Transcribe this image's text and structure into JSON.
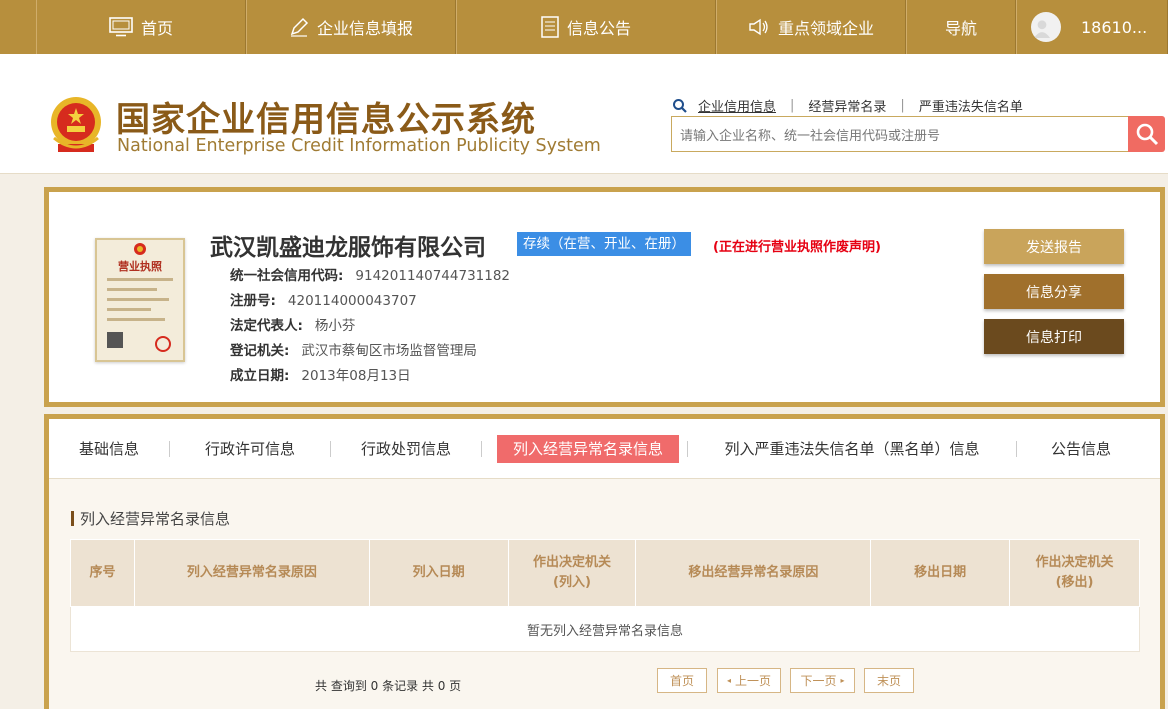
{
  "topnav": {
    "home": "首页",
    "report": "企业信息填报",
    "notice": "信息公告",
    "key": "重点领域企业",
    "guide": "导航",
    "user": "18610..."
  },
  "header": {
    "title": "国家企业信用信息公示系统",
    "subtitle": "National Enterprise Credit Information Publicity System",
    "search_tabs": [
      "企业信用信息",
      "经营异常名录",
      "严重违法失信名单"
    ],
    "search_placeholder": "请输入企业名称、统一社会信用代码或注册号"
  },
  "company": {
    "name": "武汉凯盛迪龙服饰有限公司",
    "status": "存续（在营、开业、在册）",
    "notice": "(正在进行营业执照作废声明)",
    "fields": [
      {
        "label": "统一社会信用代码:",
        "value": "914201140744731182"
      },
      {
        "label": "注册号:",
        "value": "420114000043707"
      },
      {
        "label": "法定代表人:",
        "value": "杨小芬"
      },
      {
        "label": "登记机关:",
        "value": "武汉市蔡甸区市场监督管理局"
      },
      {
        "label": "成立日期:",
        "value": "2013年08月13日"
      }
    ],
    "license_title": "营业执照"
  },
  "actions": {
    "send": "发送报告",
    "share": "信息分享",
    "print": "信息打印"
  },
  "tabs": [
    "基础信息",
    "行政许可信息",
    "行政处罚信息",
    "列入经营异常名录信息",
    "列入严重违法失信名单（黑名单）信息",
    "公告信息"
  ],
  "section": {
    "title": "列入经营异常名录信息",
    "columns": [
      "序号",
      "列入经营异常名录原因",
      "列入日期",
      "作出决定机关\n(列入)",
      "移出经营异常名录原因",
      "移出日期",
      "作出决定机关\n(移出)"
    ],
    "empty": "暂无列入经营异常名录信息"
  },
  "pager": {
    "count": "共 查询到 0 条记录 共 0 页",
    "first": "首页",
    "prev": "上一页",
    "next": "下一页",
    "last": "末页"
  },
  "colors": {
    "nav_bg": "#b78f3d",
    "brand": "#8a5a18",
    "border_gold": "#c9a24d",
    "status_blue": "#3b8ee5",
    "active_tab": "#f06b6b",
    "alert_red": "#e60012"
  }
}
